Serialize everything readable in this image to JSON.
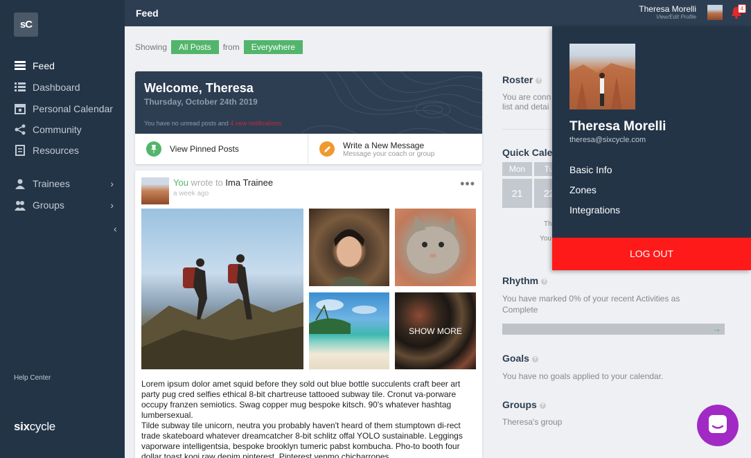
{
  "app": {
    "logo": "sC",
    "brand_pre": "six",
    "brand_post": "cycle"
  },
  "sidebar": {
    "items": [
      {
        "label": "Feed",
        "icon": "feed-icon"
      },
      {
        "label": "Dashboard",
        "icon": "dashboard-icon"
      },
      {
        "label": "Personal Calendar",
        "icon": "calendar-icon"
      },
      {
        "label": "Community",
        "icon": "community-icon"
      },
      {
        "label": "Resources",
        "icon": "resources-icon"
      },
      {
        "label": "Trainees",
        "icon": "trainees-icon"
      },
      {
        "label": "Groups",
        "icon": "groups-icon"
      }
    ],
    "help": "Help Center"
  },
  "topbar": {
    "title": "Feed",
    "user_name": "Theresa Morelli",
    "user_edit": "View/Edit Profile",
    "badge": "4"
  },
  "filter": {
    "showing": "Showing",
    "posts": "All Posts",
    "from": "from",
    "where": "Everywhere"
  },
  "welcome": {
    "title": "Welcome, Theresa",
    "date": "Thursday, October 24th 2019",
    "unread_pre": "You have no unread posts and",
    "unread_link": "4 new notifications",
    "pinned": "View Pinned Posts",
    "write": "Write a New Message",
    "write_sub": "Message your coach or group"
  },
  "post": {
    "you": "You",
    "wrote": " wrote to ",
    "who": "Ima Trainee",
    "time": "a week ago",
    "more": "•••",
    "show_more": "SHOW MORE",
    "text": "Lorem ipsum dolor amet squid before they sold out blue bottle succulents craft beer art party pug cred selfies ethical 8-bit chartreuse tattooed subway tile. Cronut va-porware occupy franzen semiotics. Swag copper mug bespoke kitsch. 90's whatever hashtag lumbersexual.\nTilde subway tile unicorn, neutra you probably haven't heard of them stumptown di-rect trade skateboard whatever dreamcatcher 8-bit schlitz offal YOLO sustainable. Leggings vaporware intelligentsia, bespoke brooklyn tumeric pabst kombucha. Pho-to booth four dollar toast kogi raw denim pinterest. Pinterest venmo chicharrones"
  },
  "right": {
    "roster_title": "Roster",
    "roster_text_1": "You are conn",
    "roster_text_2": "list and detai",
    "quick_title": "Quick Cale",
    "days": [
      "Mon",
      "Tu"
    ],
    "nums": [
      "21",
      "22"
    ],
    "cal_text_1": "Th",
    "cal_text_2": "You",
    "rhythm_title": "Rhythm",
    "rhythm_text": "You have marked 0% of your recent Activities as Complete",
    "rhythm_progress": 0,
    "goals_title": "Goals",
    "goals_text": "You have no goals applied to your calendar.",
    "groups_title": "Groups",
    "groups_text": "Theresa's group"
  },
  "dropdown": {
    "name": "Theresa Morelli",
    "email": "theresa@sixcycle.com",
    "links": [
      "Basic Info",
      "Zones",
      "Integrations"
    ],
    "logout": "LOG OUT"
  },
  "colors": {
    "sidebar": "#233447",
    "topbar": "#2d3e52",
    "accent_green": "#52b56b",
    "logout_red": "#ff1a1a",
    "chat_purple": "#a22ac4"
  }
}
